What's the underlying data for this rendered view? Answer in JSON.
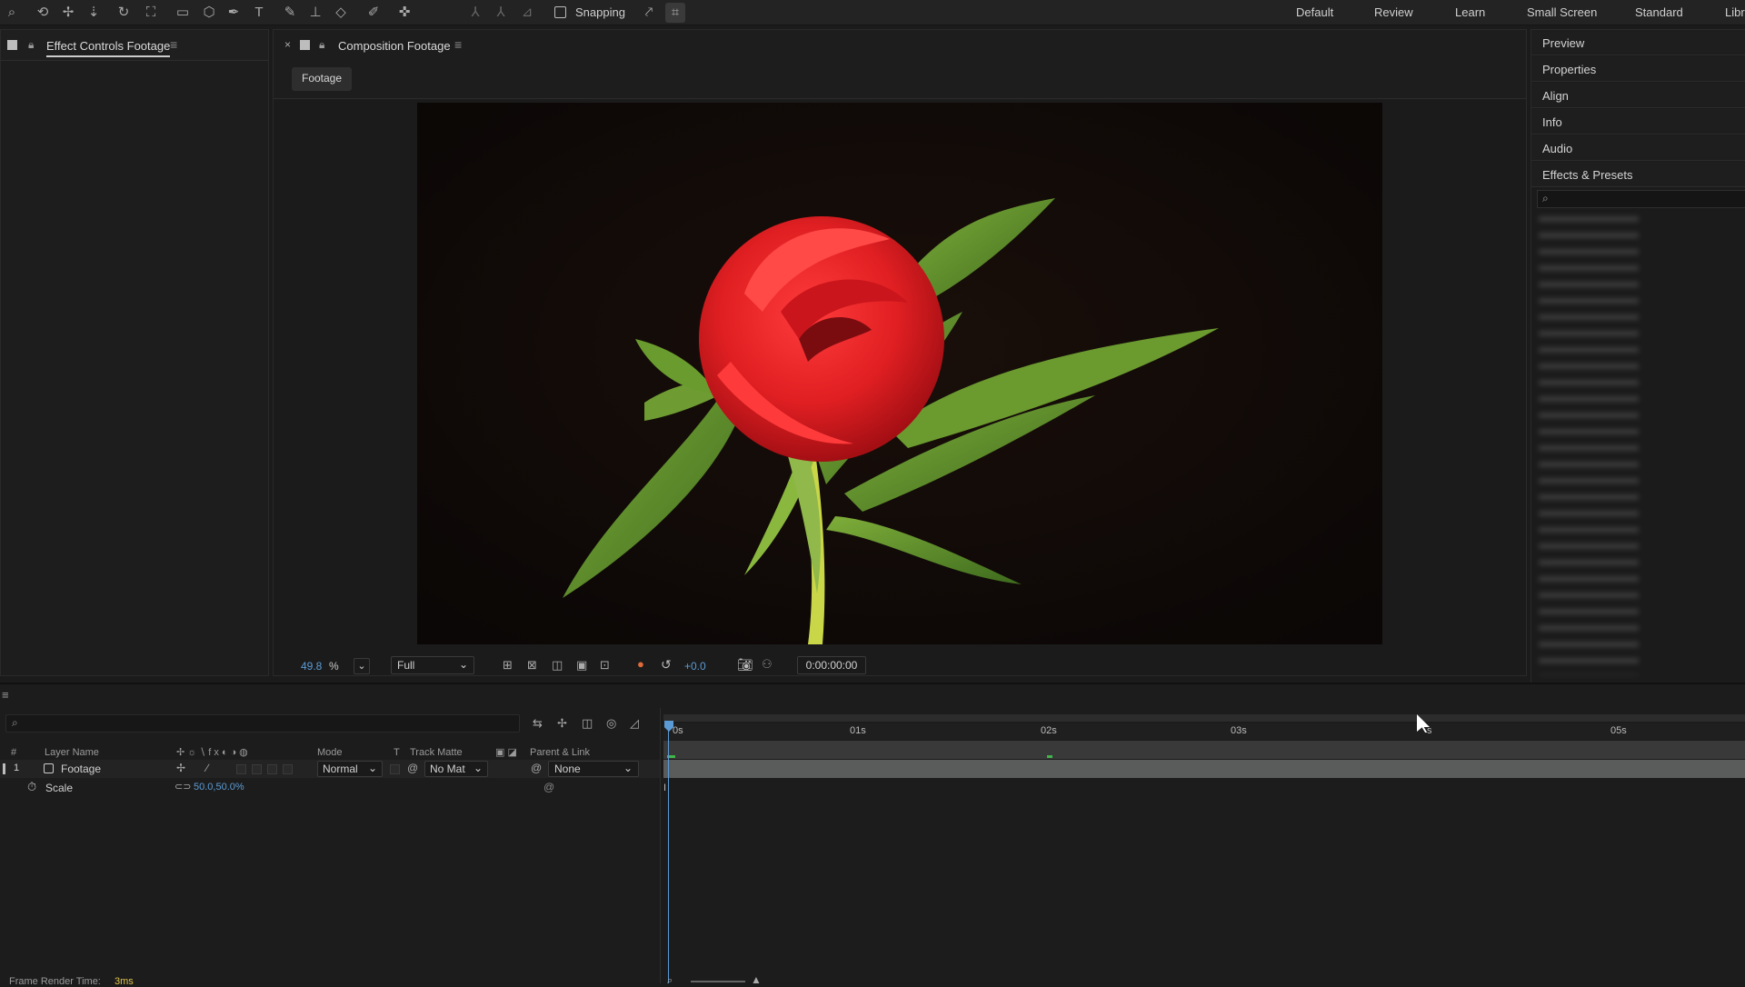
{
  "toolbar": {
    "snapping_label": "Snapping",
    "workspaces": [
      "Default",
      "Review",
      "Learn",
      "Small Screen",
      "Standard",
      "Libr"
    ]
  },
  "left_panel": {
    "tab_title": "Effect Controls Footage"
  },
  "comp_panel": {
    "tab_title": "Composition Footage",
    "breadcrumb_label": "Footage",
    "zoom_value": "49.8",
    "zoom_unit": "%",
    "resolution": "Full",
    "exposure": "+0.0",
    "timecode": "0:00:00:00"
  },
  "right_panel": {
    "items": [
      "Preview",
      "Properties",
      "Align",
      "Info",
      "Audio",
      "Effects & Presets"
    ]
  },
  "timeline": {
    "columns": {
      "number": "#",
      "layer_name": "Layer Name",
      "mode": "Mode",
      "t": "T",
      "track_matte": "Track Matte",
      "parent_link": "Parent & Link"
    },
    "layer": {
      "index": "1",
      "name": "Footage",
      "mode": "Normal",
      "track_matte": "No Mat",
      "parent": "None"
    },
    "property": {
      "name": "Scale",
      "value": "50.0,50.0%"
    },
    "ruler_ticks": [
      "0s",
      "01s",
      "02s",
      "03s",
      "s",
      "05s"
    ],
    "footer_label": "Frame Render Time:",
    "footer_value": "3ms"
  },
  "colors": {
    "accent_blue": "#5b9bd5",
    "bar_green": "#3fb54a"
  }
}
